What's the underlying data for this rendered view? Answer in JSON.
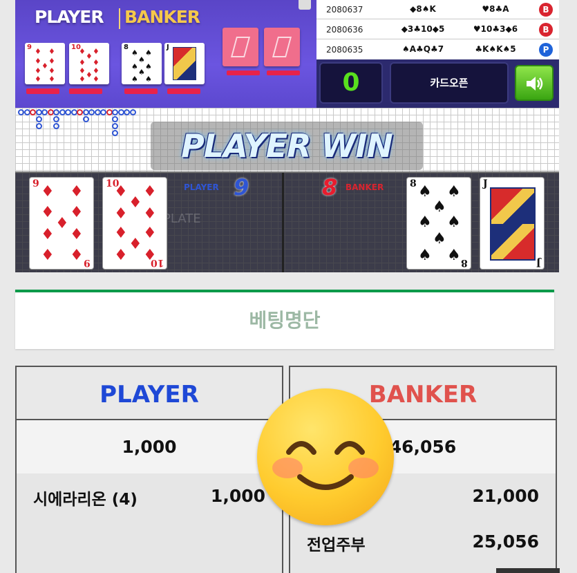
{
  "table": {
    "player_label": "PLAYER",
    "banker_label": "BANKER"
  },
  "history": [
    {
      "id": "2080637",
      "player": "◆8♠K",
      "banker": "♥8♣A",
      "result": "B"
    },
    {
      "id": "2080636",
      "player": "◆3♣10◆5",
      "banker": "♥10♣3◆6",
      "result": "B"
    },
    {
      "id": "2080635",
      "player": "♠A♣Q♣7",
      "banker": "♣K♠K♠5",
      "result": "P"
    }
  ],
  "controls": {
    "score": "0",
    "open_button": "카드오픈",
    "sound_icon": "speaker-icon"
  },
  "banner": {
    "text": "PLAYER WIN"
  },
  "hands": {
    "player_label": "PLAYER",
    "player_score": "9",
    "banker_label": "BANKER",
    "banker_score": "8",
    "player_cards": [
      {
        "rank": "9",
        "suit": "♦",
        "color": "#d8202b"
      },
      {
        "rank": "10",
        "suit": "♦",
        "color": "#d8202b"
      }
    ],
    "banker_cards": [
      {
        "rank": "8",
        "suit": "♠",
        "color": "#111111"
      },
      {
        "rank": "J",
        "suit": "♠",
        "color": "#111111"
      }
    ],
    "watermark": "PLATE"
  },
  "betting": {
    "title": "베팅명단",
    "player": {
      "header": "PLAYER",
      "total": "1,000",
      "rows": [
        {
          "name": "시에라리온 (4)",
          "amount": "1,000"
        }
      ]
    },
    "banker": {
      "header": "BANKER",
      "total": "46,056",
      "rows": [
        {
          "name": "",
          "amount": "21,000"
        },
        {
          "name": "전업주부",
          "amount": "25,056"
        }
      ]
    }
  },
  "overlay": {
    "emoji": "smiling-face-emoji"
  },
  "colors": {
    "player": "#1e48d6",
    "banker": "#e0524d",
    "accent_green": "#0d9a4a"
  }
}
